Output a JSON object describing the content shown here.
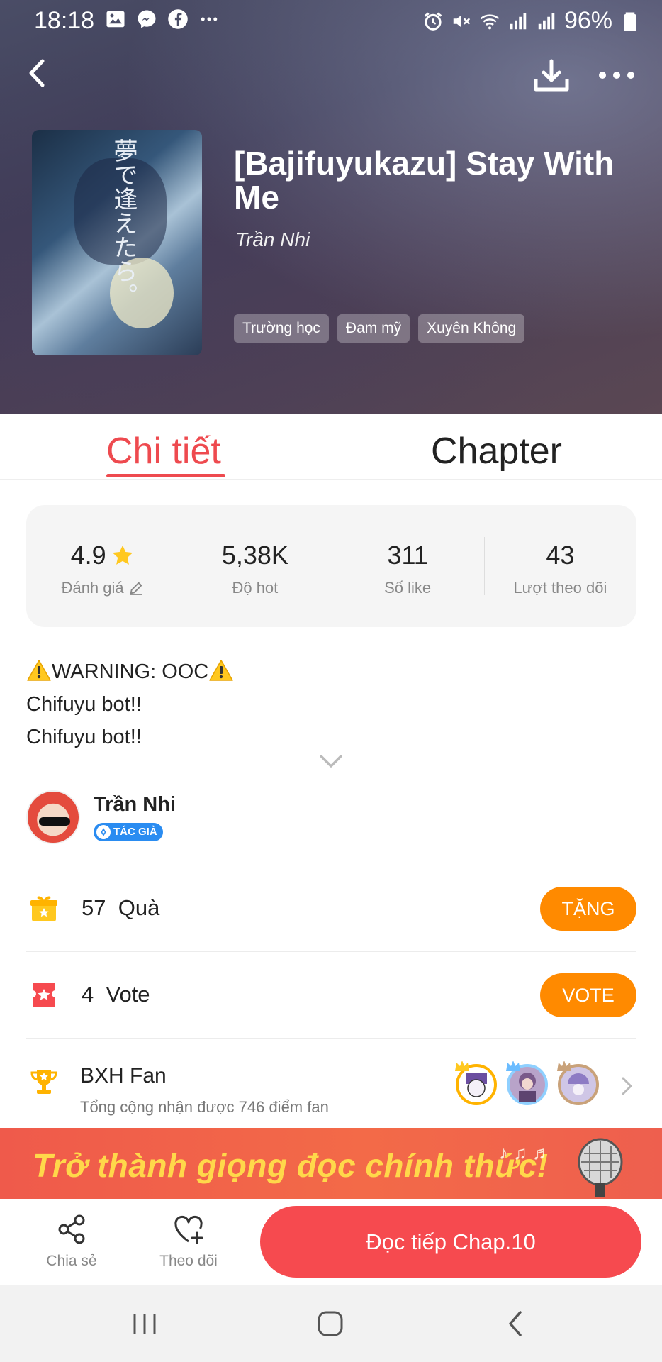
{
  "status_bar": {
    "time": "18:18",
    "battery": "96%",
    "left_icons": [
      "image-icon",
      "messenger-icon",
      "facebook-icon",
      "more-dots-icon"
    ],
    "right_icons": [
      "alarm-icon",
      "mute-icon",
      "wifi-icon",
      "signal-icon",
      "battery-icon"
    ]
  },
  "header": {
    "title": "[Bajifuyukazu] Stay With Me",
    "author": "Trần Nhi",
    "cover_text": "夢で逢えたら。",
    "tags": [
      "Trường học",
      "Đam mỹ",
      "Xuyên Không"
    ]
  },
  "tabs": [
    {
      "label": "Chi tiết",
      "active": true
    },
    {
      "label": "Chapter",
      "active": false
    }
  ],
  "stats": [
    {
      "value": "4.9",
      "label": "Đánh giá"
    },
    {
      "value": "5,38K",
      "label": "Độ hot"
    },
    {
      "value": "311",
      "label": "Số like"
    },
    {
      "value": "43",
      "label": "Lượt theo dõi"
    }
  ],
  "description": {
    "line1": "WARNING: OOC",
    "line2": "Chifuyu bot!!",
    "line3": "Chifuyu bot!!"
  },
  "author_row": {
    "name": "Trần Nhi",
    "badge": "TÁC GIẢ"
  },
  "gift": {
    "count": "57",
    "label": "Quà",
    "button": "TẶNG"
  },
  "vote": {
    "count": "4",
    "label": "Vote",
    "button": "VOTE"
  },
  "fan": {
    "title": "BXH Fan",
    "subtitle": "Tổng cộng nhận được 746 điểm fan"
  },
  "banner": {
    "text": "Trở thành giọng đọc chính thức!"
  },
  "actions": {
    "share": "Chia sẻ",
    "follow": "Theo dõi",
    "read": "Đọc tiếp Chap.10"
  },
  "colors": {
    "accent_red": "#f64a4f",
    "tab_active": "#ee4a4f",
    "button_orange": "#ff8a00",
    "badge_blue": "#2a8cf1",
    "banner_yellow": "#ffd84a"
  }
}
